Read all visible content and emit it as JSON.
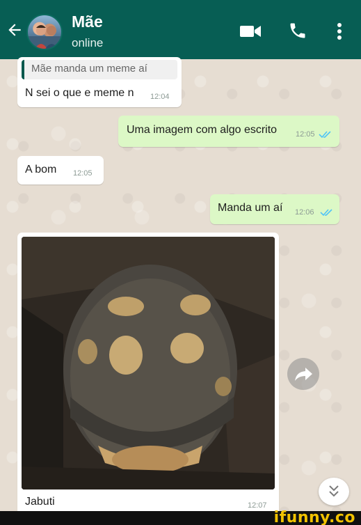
{
  "header": {
    "contact_name": "Mãe",
    "status": "online",
    "icons": [
      "back-arrow-icon",
      "video-call-icon",
      "phone-call-icon",
      "more-options-icon"
    ],
    "bg_color": "#075e54"
  },
  "messages": {
    "reply": {
      "quoted_text": "Mãe manda um meme aí",
      "text": "N sei o que e meme n",
      "time": "12:04"
    },
    "out1": {
      "text": "Uma imagem com algo escrito",
      "time": "12:05"
    },
    "in1": {
      "text": "A bom",
      "time": "12:05"
    },
    "out2": {
      "text": "Manda um aí",
      "time": "12:06"
    },
    "image_msg": {
      "caption": "Jabuti",
      "time": "12:07",
      "image": "tortoise-photo"
    }
  },
  "colors": {
    "outgoing_bubble": "#dcf8c6",
    "incoming_bubble": "#ffffff",
    "read_ticks": "#4fc3f7"
  },
  "watermark": "ifunny.co"
}
